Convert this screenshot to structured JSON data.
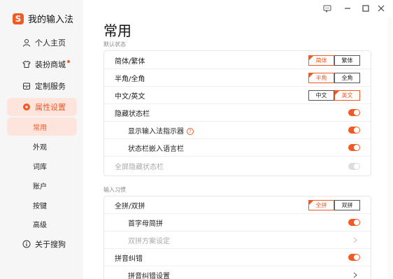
{
  "app": {
    "logo_glyph": "S",
    "title": "我的输入法",
    "accent": "#f15a24"
  },
  "titlebar": {
    "icons": [
      "feedback-icon",
      "minimize-icon",
      "maximize-icon",
      "close-icon"
    ]
  },
  "sidebar": {
    "items": [
      {
        "label": "个人主页",
        "icon": "user-icon"
      },
      {
        "label": "装扮商城",
        "icon": "shirt-icon",
        "badge_dot": true
      },
      {
        "label": "定制服务",
        "icon": "box-icon"
      },
      {
        "label": "属性设置",
        "icon": "settings-icon",
        "active": true
      },
      {
        "label": "关于搜狗",
        "icon": "info-icon"
      }
    ],
    "sub_items": [
      {
        "label": "常用",
        "active": true
      },
      {
        "label": "外观"
      },
      {
        "label": "词库"
      },
      {
        "label": "账户"
      },
      {
        "label": "按键"
      },
      {
        "label": "高级"
      }
    ]
  },
  "main": {
    "title": "常用",
    "sections": [
      {
        "label": "默认状态",
        "rows": [
          {
            "label": "简体/繁体",
            "type": "segmented",
            "options": [
              "简体",
              "繁体"
            ],
            "selected": 0
          },
          {
            "label": "半角/全角",
            "type": "segmented",
            "options": [
              "半角",
              "全角"
            ],
            "selected": 0
          },
          {
            "label": "中文/英文",
            "type": "segmented",
            "options": [
              "中文",
              "英文"
            ],
            "selected": 1
          },
          {
            "label": "隐藏状态栏",
            "type": "toggle",
            "on": true
          },
          {
            "label": "显示输入法指示器",
            "type": "toggle",
            "on": true,
            "indent": true,
            "help": "?"
          },
          {
            "label": "状态栏嵌入语言栏",
            "type": "toggle",
            "on": true,
            "indent": true
          },
          {
            "label": "全屏隐藏状态栏",
            "type": "toggle",
            "on": true,
            "disabled": true
          }
        ]
      },
      {
        "label": "输入习惯",
        "rows": [
          {
            "label": "全拼/双拼",
            "type": "segmented",
            "options": [
              "全拼",
              "双拼"
            ],
            "selected": 0
          },
          {
            "label": "首字母简拼",
            "type": "toggle",
            "on": true,
            "indent": true
          },
          {
            "label": "双拼方案设定",
            "type": "link",
            "indent": true,
            "disabled": true
          },
          {
            "label": "拼音纠错",
            "type": "toggle",
            "on": true
          },
          {
            "label": "拼音纠错设置",
            "type": "link",
            "indent": true
          }
        ]
      }
    ]
  }
}
